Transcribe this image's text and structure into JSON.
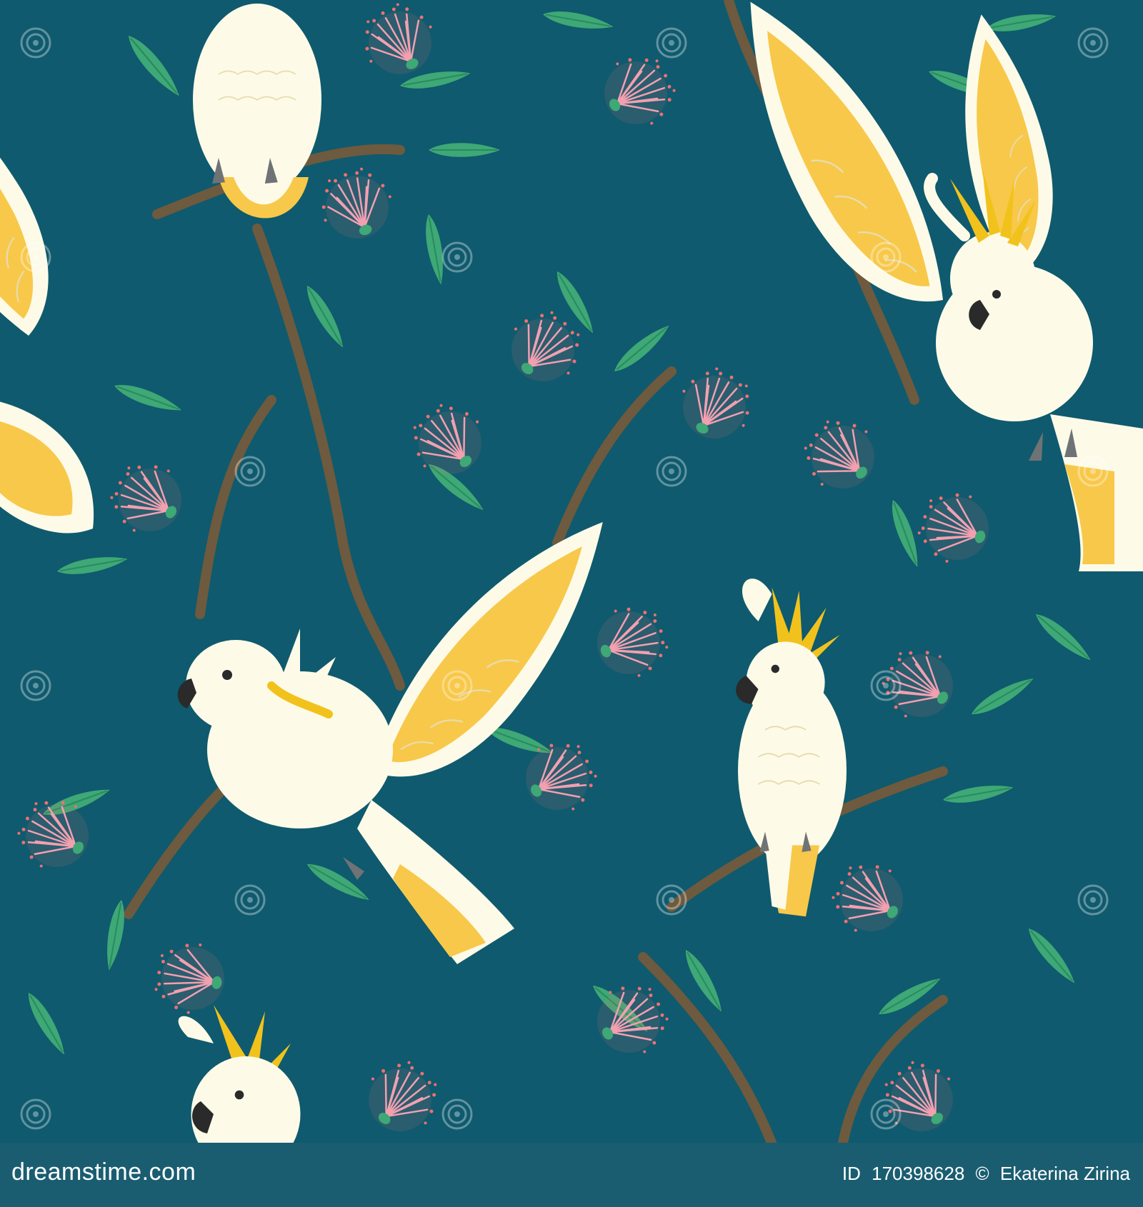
{
  "image": {
    "subject": "seamless pattern of white sulphur-crested cockatoos on eucalyptus branches with pink blossoms",
    "watermark_text": "dreamstime",
    "colors": {
      "background": "#0f5a6e",
      "footer": "#1a5d70",
      "leaf": "#3ea876",
      "leaf_dark": "#2a8a5e",
      "branch": "#6e5a3e",
      "blossom": "#f2a0b0",
      "blossom_dot": "#f07070",
      "bird_white": "#fdfbe8",
      "bird_yellow": "#f8c84a",
      "crest": "#f2c21c",
      "beak": "#2a2a2a",
      "feet": "#6f7376"
    }
  },
  "footer": {
    "site": "dreamstime.com",
    "id_label": "ID",
    "id_value": "170398628",
    "copyright": "©",
    "author": "Ekaterina Zirina"
  }
}
